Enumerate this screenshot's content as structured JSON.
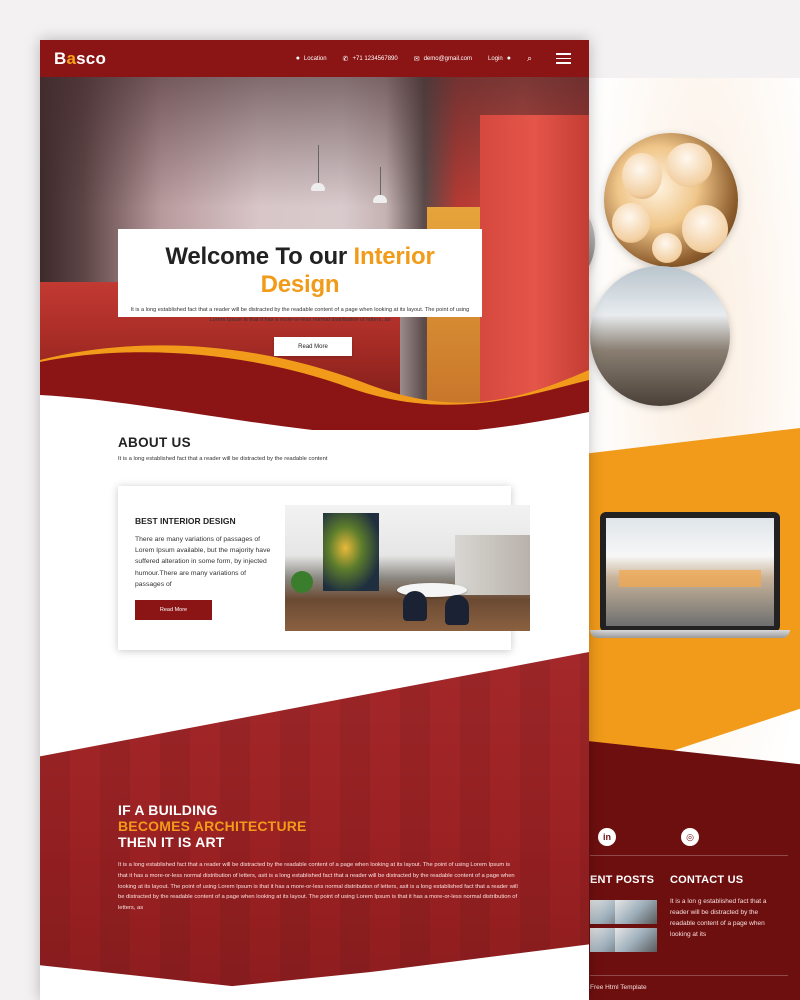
{
  "brand": {
    "logo_first": "B",
    "logo_accent": "a",
    "logo_rest": "sco"
  },
  "nav": {
    "location": "Location",
    "phone": "+71 1234567890",
    "email": "demo@gmail.com",
    "login": "Login"
  },
  "hero": {
    "title_plain": "Welcome To our ",
    "title_highlight": "Interior Design",
    "text": "It is a long established fact that a reader will be distracted by the readable content of a page when looking at its layout. The point of using Lorem Ipsum is that it has a more-or-less normal distribution of letters, as",
    "button": "Read More"
  },
  "about": {
    "title": "ABOUT US",
    "text": "It is a long established fact that a reader will be distracted by the readable content"
  },
  "card": {
    "title": "BEST INTERIOR DESIGN",
    "text": "There are many variations of passages of Lorem Ipsum available, but the majority have suffered alteration in some form, by injected humour.There are many variations of passages of",
    "button": "Read More"
  },
  "architecture": {
    "line1": "IF A BUILDING",
    "line2": "BECOMES ARCHITECTURE",
    "line3": "THEN IT IS ART",
    "text": "It is a long established fact that a reader will be distracted by the readable content of a page when looking at its layout. The point of using Lorem Ipsum is that it has a more-or-less normal distribution of letters, asit is a long established fact that a reader will be distracted by the readable content of a page when looking at its layout. The point of using Lorem Ipsum is that it has a more-or-less normal distribution of letters, asit is a long established fact that a reader will be distracted by the readable content of a page when looking at its layout. The point of using Lorem Ipsum is that it has a more-or-less normal distribution of letters, as"
  },
  "back_footer": {
    "recent_posts": "ENT POSTS",
    "contact_title": "CONTACT US",
    "contact_text": "It is a lon g established fact that a reader will be distracted by the readable content of a page when looking at its",
    "copyright": "Free Html Template",
    "social_1": "in",
    "social_2": "◎"
  },
  "colors": {
    "primary": "#8b1414",
    "accent": "#f29b1a",
    "dark_footer": "#6e0f0f"
  },
  "icons": [
    "location-pin-icon",
    "phone-icon",
    "mail-icon",
    "user-icon",
    "search-icon",
    "menu-icon",
    "linkedin-icon",
    "instagram-icon"
  ]
}
